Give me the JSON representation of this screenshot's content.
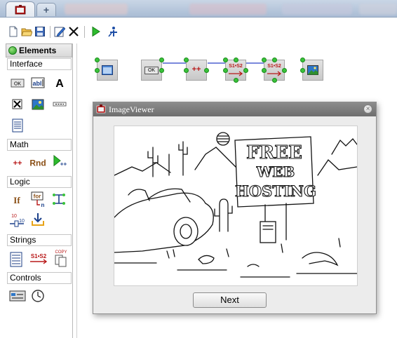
{
  "browser": {
    "tabs": [
      {
        "name": "app-tab",
        "active": true
      },
      {
        "name": "new-tab",
        "label": "+"
      }
    ]
  },
  "toolbar": {
    "buttons": [
      "new-document-icon",
      "open-folder-icon",
      "save-icon",
      "edit-icon",
      "delete-icon",
      "run-icon",
      "debug-icon"
    ]
  },
  "palette": {
    "title": "Elements",
    "sections": [
      {
        "label": "Interface",
        "items": [
          "ok-button-icon",
          "text-field-icon",
          "label-icon",
          "checkbox-icon",
          "image-icon",
          "separator-icon",
          "text-area-icon"
        ]
      },
      {
        "label": "Math",
        "items": [
          "plus-plus-icon",
          "random-icon",
          "counter-icon"
        ]
      },
      {
        "label": "Logic",
        "items": [
          "if-icon",
          "for-loop-icon",
          "connector-icon",
          "range-icon",
          "download-icon"
        ]
      },
      {
        "label": "Strings",
        "items": [
          "string-list-icon",
          "string-replace-icon",
          "copy-icon"
        ]
      },
      {
        "label": "Controls",
        "items": [
          "control-panel-icon",
          "clock-icon"
        ]
      }
    ],
    "icon_labels": {
      "ok": "OK",
      "textfield": "abl",
      "label": "A",
      "plusplus": "++",
      "random": "Rnd",
      "counter": "++",
      "if": "If",
      "for": "for",
      "for_n": "n",
      "range_top": "10",
      "range_bottom": "10",
      "s1s2": "S1•S2",
      "copy": "COPY"
    }
  },
  "canvas": {
    "nodes": [
      {
        "name": "window-node",
        "icon": "window-icon"
      },
      {
        "name": "button-node",
        "label": "OK"
      },
      {
        "name": "increment-node",
        "label": "++"
      },
      {
        "name": "string-replace-node-1",
        "label": "S1•S2"
      },
      {
        "name": "string-replace-node-2",
        "label": "S1•S2"
      },
      {
        "name": "image-node",
        "icon": "image-icon"
      }
    ]
  },
  "image_viewer": {
    "title": "ImageViewer",
    "close": "×",
    "next_button": "Next",
    "cartoon_sign": [
      "FREE",
      "WEB",
      "HOSTING"
    ]
  },
  "colors": {
    "pin_green": "#39c23a",
    "title_bar": "#7a7a7a",
    "accent_red": "#c8102e"
  }
}
